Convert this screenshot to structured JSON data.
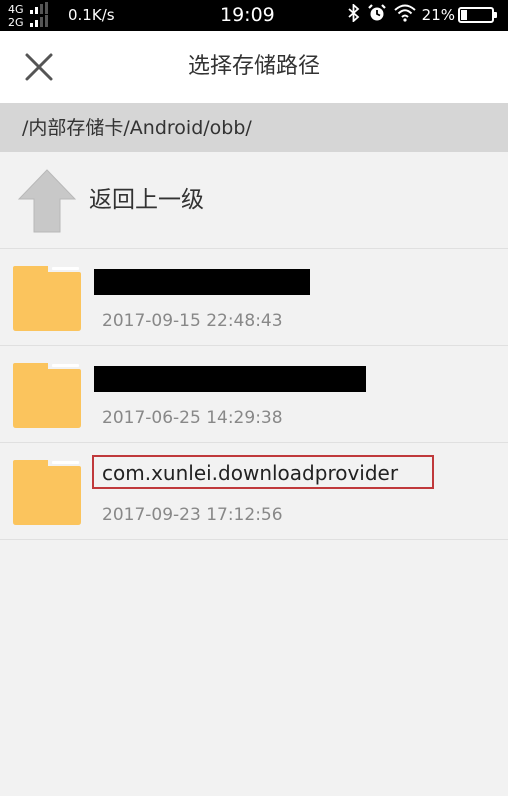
{
  "status_bar": {
    "network_line1": "4G",
    "network_line2": "2G",
    "speed": "0.1K/s",
    "time": "19:09",
    "battery_percent": "21%",
    "battery_level": 0.21,
    "icons": [
      "bluetooth-icon",
      "alarm-icon",
      "wifi-icon",
      "battery-icon"
    ]
  },
  "header": {
    "title": "选择存储路径",
    "close_icon": "close-icon"
  },
  "path_bar": {
    "path": "/内部存储卡/Android/obb/"
  },
  "back_row": {
    "label": "返回上一级",
    "icon": "up-arrow-icon"
  },
  "files": [
    {
      "name": "",
      "date": "2017-09-15 22:48:43",
      "redacted": true,
      "highlighted": false,
      "icon": "folder-icon"
    },
    {
      "name": "",
      "date": "2017-06-25 14:29:38",
      "redacted": true,
      "highlighted": false,
      "icon": "folder-icon"
    },
    {
      "name": "com.xunlei.downloadprovider",
      "date": "2017-09-23 17:12:56",
      "redacted": false,
      "highlighted": true,
      "icon": "folder-icon"
    }
  ],
  "colors": {
    "folder": "#fbc45d",
    "folder_tab": "#f4b343",
    "highlight_border": "#c0393b",
    "path_bar_bg": "#d6d6d6",
    "background": "#f2f2f2"
  }
}
